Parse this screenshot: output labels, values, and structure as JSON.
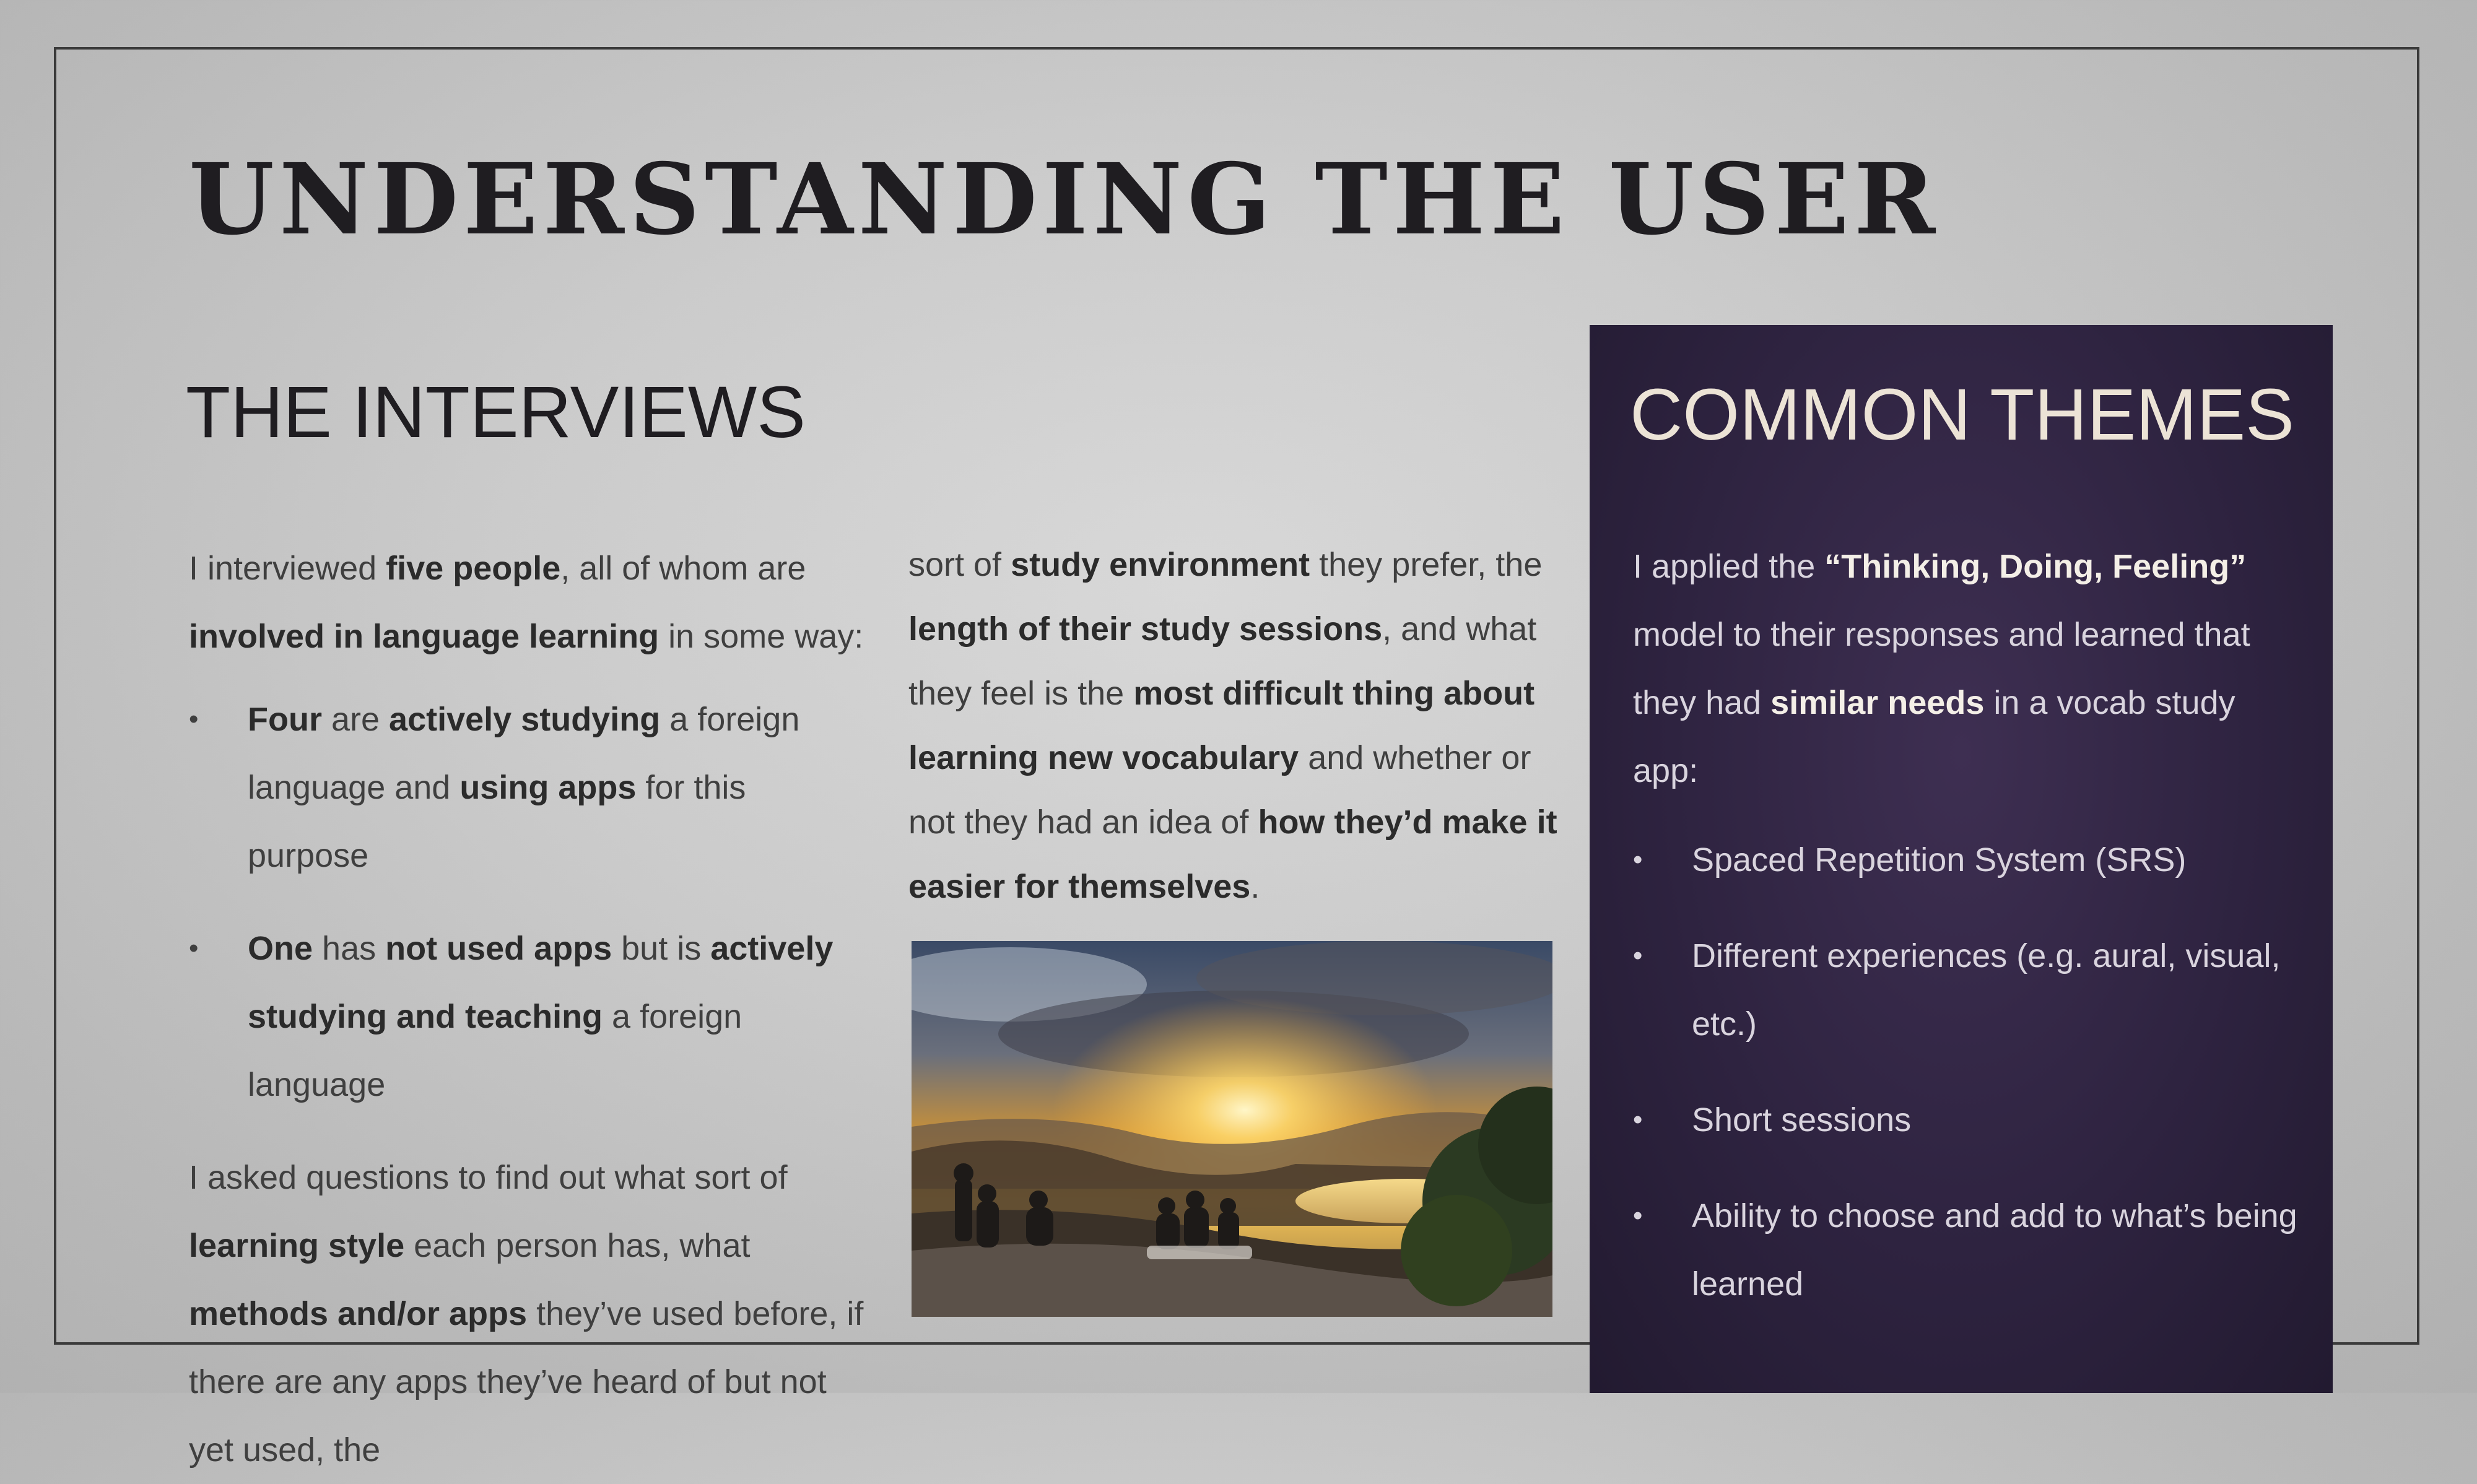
{
  "slide": {
    "title": "UNDERSTANDING THE USER"
  },
  "interviews": {
    "heading": "THE INTERVIEWS",
    "intro": [
      {
        "t": "I interviewed "
      },
      {
        "t": "five people",
        "b": true
      },
      {
        "t": ", all of whom are "
      },
      {
        "t": "involved in language learning",
        "b": true
      },
      {
        "t": " in some way:"
      }
    ],
    "bullets": [
      [
        {
          "t": "Four",
          "b": true
        },
        {
          "t": " are "
        },
        {
          "t": "actively studying",
          "b": true
        },
        {
          "t": " a foreign language and "
        },
        {
          "t": "using apps",
          "b": true
        },
        {
          "t": " for this purpose"
        }
      ],
      [
        {
          "t": "One",
          "b": true
        },
        {
          "t": " has "
        },
        {
          "t": "not used apps",
          "b": true
        },
        {
          "t": " but is "
        },
        {
          "t": "actively studying and teaching",
          "b": true
        },
        {
          "t": " a foreign language"
        }
      ]
    ],
    "questions": [
      {
        "t": "I asked questions to find out what sort of "
      },
      {
        "t": "learning style",
        "b": true
      },
      {
        "t": " each person has, what "
      },
      {
        "t": "methods and/or apps",
        "b": true
      },
      {
        "t": " they’ve used before, if there are any apps they’ve heard of but not yet used, the"
      }
    ],
    "continued": [
      {
        "t": "sort of "
      },
      {
        "t": "study environment",
        "b": true
      },
      {
        "t": " they prefer, the "
      },
      {
        "t": "length of their study sessions",
        "b": true
      },
      {
        "t": ", and what they feel is the "
      },
      {
        "t": "most difficult thing about learning new vocabulary",
        "b": true
      },
      {
        "t": " and whether or not they had an idea of "
      },
      {
        "t": "how they’d make it easier for themselves",
        "b": true
      },
      {
        "t": "."
      }
    ]
  },
  "themes": {
    "heading": "COMMON THEMES",
    "intro": [
      {
        "t": "I applied the "
      },
      {
        "t": "“Thinking, Doing, Feeling”",
        "b": true
      },
      {
        "t": " model to their responses and learned that they had "
      },
      {
        "t": "similar needs",
        "b": true
      },
      {
        "t": " in a vocab study app:"
      }
    ],
    "bullets": [
      "Spaced Repetition System (SRS)",
      "Different experiences (e.g. aural, visual, etc.)",
      "Short sessions",
      "Ability to choose and add to what’s being learned"
    ]
  },
  "bullet_glyph": "•",
  "colors": {
    "panel": "#2e2340",
    "heading_light": "#ece3d6",
    "title": "#1f1d21"
  }
}
